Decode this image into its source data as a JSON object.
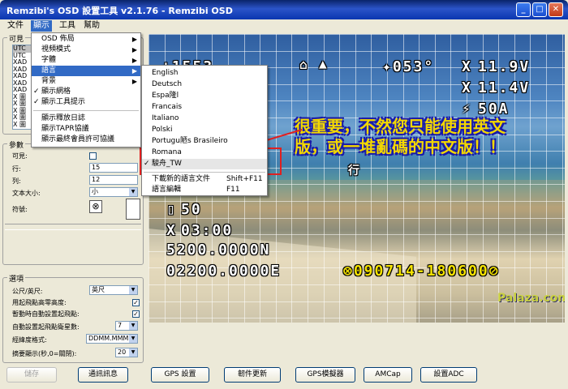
{
  "window": {
    "title": "Remzibi's OSD 設置工具 v2.1.76 - Remzibi OSD",
    "watermark": "Palaza.com"
  },
  "menubar": {
    "items": [
      "文件",
      "顯示",
      "工具",
      "幫助"
    ],
    "active_index": 1
  },
  "left_panel": {
    "visible_label": "可見",
    "items_list": [
      "UTC",
      "UTC",
      "XAD",
      "XAD",
      "XAD",
      "XAD",
      "XAD",
      "X 圖",
      "X 圖",
      "X 圖",
      "X 圖",
      "X 圖"
    ],
    "params_label": "參數",
    "rows": [
      {
        "label": "可見:",
        "value": ""
      },
      {
        "label": "行:",
        "value": "15"
      },
      {
        "label": "列:",
        "value": "12"
      },
      {
        "label": "文本大小:",
        "value": "小"
      }
    ],
    "symbol_label": "符號:",
    "options_label": "選項",
    "unit_label": "公尺/英尺:",
    "unit_value": "英尺",
    "opt_rows": [
      {
        "label": "用起飛點高零高度:",
        "checked": true
      },
      {
        "label": "暫動時自動設置起飛點:",
        "checked": true
      }
    ],
    "min_sats_label": "自動設置起飛點衛星數:",
    "min_sats_value": "7",
    "latlon_label": "經緯度格式:",
    "latlon_value": "DDMM.MMMM",
    "summary_label": "摘要顯示(秒,0=關閉):",
    "summary_value": "20"
  },
  "display_menu": {
    "items": [
      {
        "label": "OSD 佈局",
        "submenu": true,
        "checked": false
      },
      {
        "label": "視頻模式",
        "submenu": true,
        "checked": false
      },
      {
        "label": "字體",
        "submenu": true,
        "checked": false
      },
      {
        "label": "語言",
        "submenu": true,
        "checked": false,
        "highlighted": true
      },
      {
        "label": "背景",
        "submenu": true,
        "checked": false
      },
      {
        "label": "顯示網格",
        "submenu": false,
        "checked": true
      },
      {
        "label": "顯示工具提示",
        "submenu": false,
        "checked": true
      },
      {
        "label": "顯示釋放日誌",
        "submenu": false,
        "checked": false
      },
      {
        "label": "顯示TAPR協議",
        "submenu": false,
        "checked": false
      },
      {
        "label": "顯示最終會員許可協議",
        "submenu": false,
        "checked": false
      }
    ]
  },
  "language_menu": {
    "items": [
      {
        "label": "English",
        "checked": false
      },
      {
        "label": "Deutsch",
        "checked": false
      },
      {
        "label": "Espa隆l",
        "checked": false
      },
      {
        "label": "Francais",
        "checked": false
      },
      {
        "label": "Italiano",
        "checked": false
      },
      {
        "label": "Polski",
        "checked": false
      },
      {
        "label": "Portugu陋s Brasileiro",
        "checked": false
      },
      {
        "label": "Romana",
        "checked": false
      },
      {
        "label": "駿舟_TW",
        "checked": true
      }
    ],
    "extra": [
      {
        "label": "下載新的語言文件",
        "shortcut": "Shift+F11"
      },
      {
        "label": "語言編輯",
        "shortcut": "F11"
      }
    ]
  },
  "osd": {
    "top_left": "+1553",
    "gps": "✦053°",
    "batt_v1": "11.9V",
    "batt_v2": "11.4V",
    "amps": "50A",
    "v1_prefix": "X",
    "v2_prefix": "X",
    "amps_prefix": "⚡",
    "row_left": "行",
    "alt": "50",
    "time": "03:00",
    "coord_n": "5200.0000N",
    "coord_e": "02200.0000E",
    "datetime": "⊗090714-180600⊘",
    "annotation": "很重要，不然您只能使用英文版，或一堆亂碼的中文版！！"
  },
  "buttons": [
    {
      "label": "儲存",
      "enabled": false
    },
    {
      "label": "通訊訊息",
      "enabled": true
    },
    {
      "label": "GPS 設置",
      "enabled": true
    },
    {
      "label": "韌件更新",
      "enabled": true
    },
    {
      "label": "GPS模擬器",
      "enabled": true
    },
    {
      "label": "AMCap",
      "enabled": true
    },
    {
      "label": "設置ADC",
      "enabled": true
    }
  ]
}
